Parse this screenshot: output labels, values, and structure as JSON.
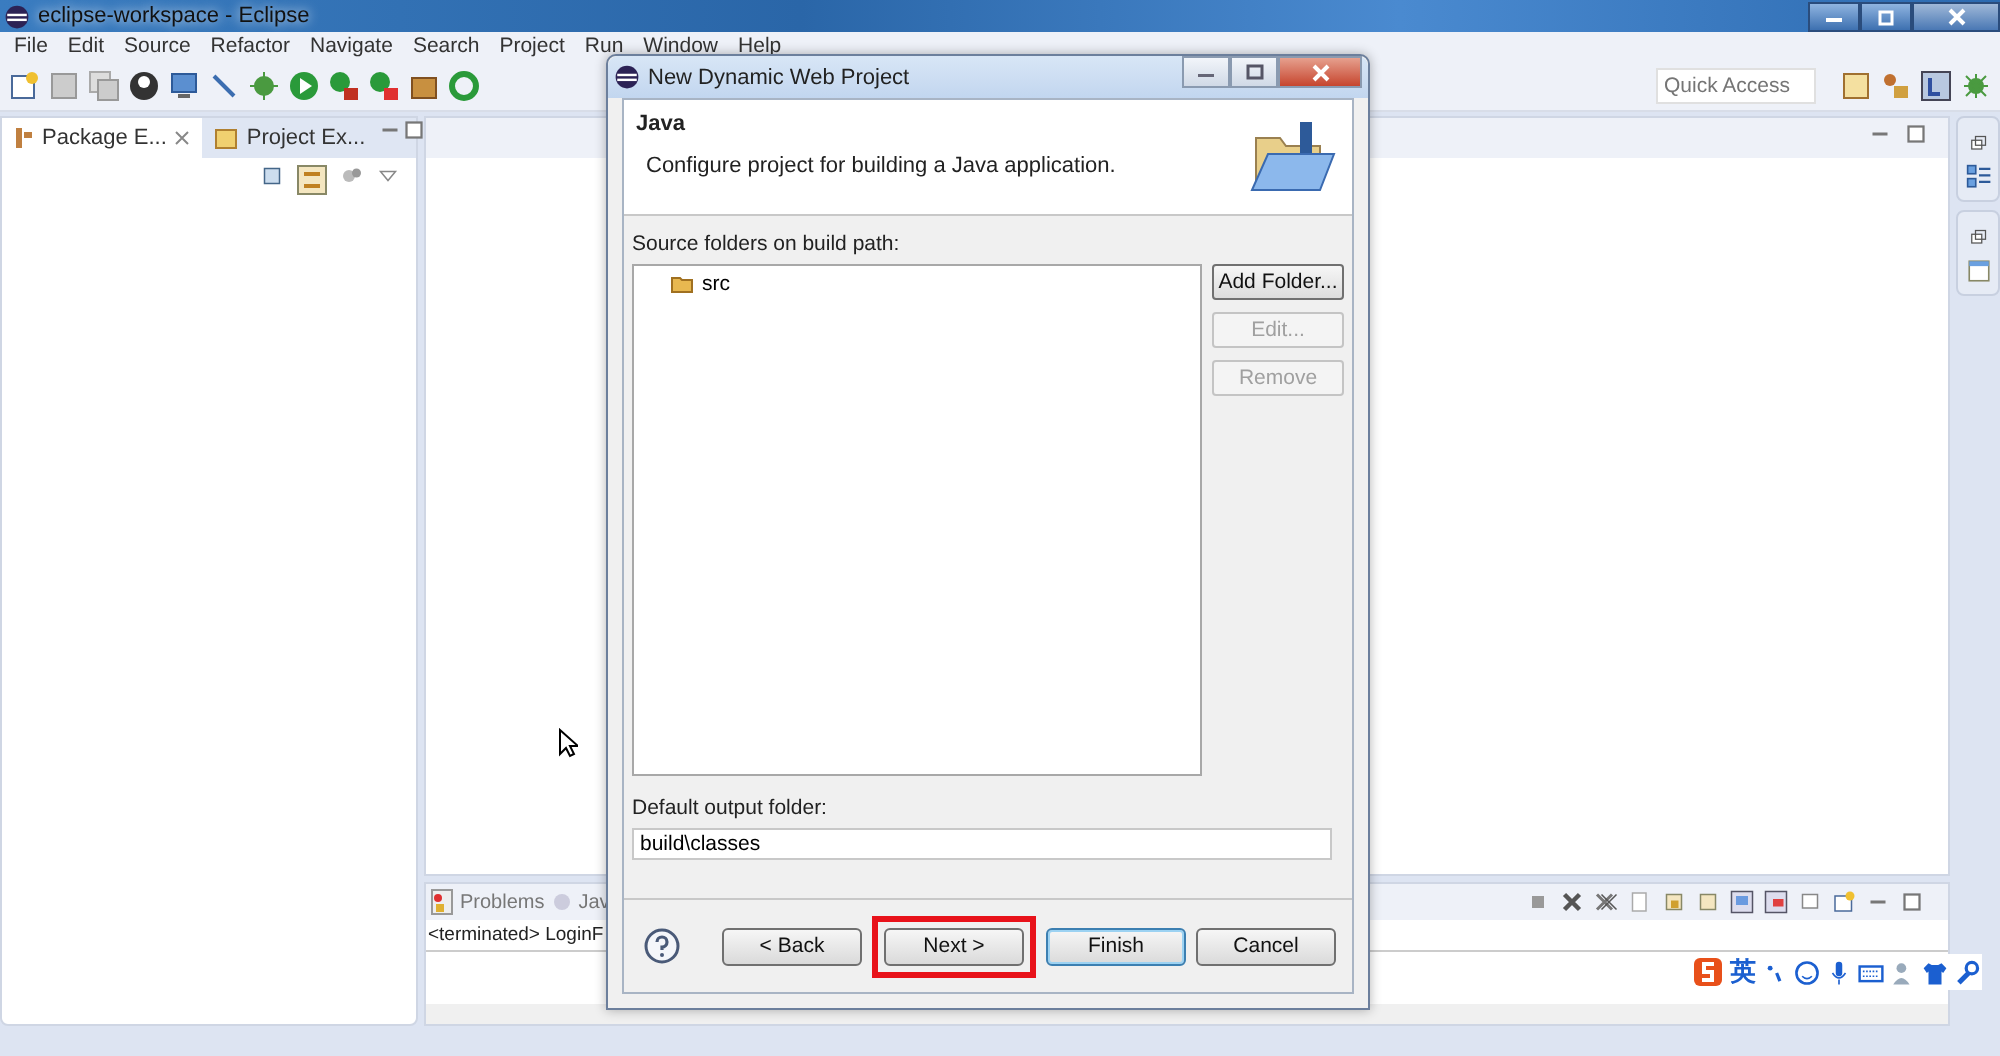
{
  "window": {
    "title": "eclipse-workspace - Eclipse"
  },
  "menu": [
    "File",
    "Edit",
    "Source",
    "Refactor",
    "Navigate",
    "Search",
    "Project",
    "Run",
    "Window",
    "Help"
  ],
  "quick_access": {
    "placeholder": "Quick Access"
  },
  "left_tabs": [
    {
      "label": "Package E...",
      "selected": true
    },
    {
      "label": "Project Ex...",
      "selected": false
    }
  ],
  "bottom_panel": {
    "tabs": [
      "Problems",
      "Jav"
    ],
    "console_line": "<terminated> LoginF"
  },
  "dialog": {
    "title": "New Dynamic Web Project",
    "heading": "Java",
    "description": "Configure project for building a Java application.",
    "source_label": "Source folders on build path:",
    "source_folders": [
      {
        "name": "src"
      }
    ],
    "side_buttons": [
      {
        "label": "Add Folder...",
        "disabled": false
      },
      {
        "label": "Edit...",
        "disabled": true
      },
      {
        "label": "Remove",
        "disabled": true
      }
    ],
    "output_label": "Default output folder:",
    "output_value": "build\\classes",
    "buttons": [
      {
        "label": "< Back",
        "highlighted": false,
        "default": false
      },
      {
        "label": "Next >",
        "highlighted": true,
        "default": false
      },
      {
        "label": "Finish",
        "highlighted": false,
        "default": true
      },
      {
        "label": "Cancel",
        "highlighted": false,
        "default": false
      }
    ]
  },
  "ime_bar": {
    "mode": "英"
  }
}
